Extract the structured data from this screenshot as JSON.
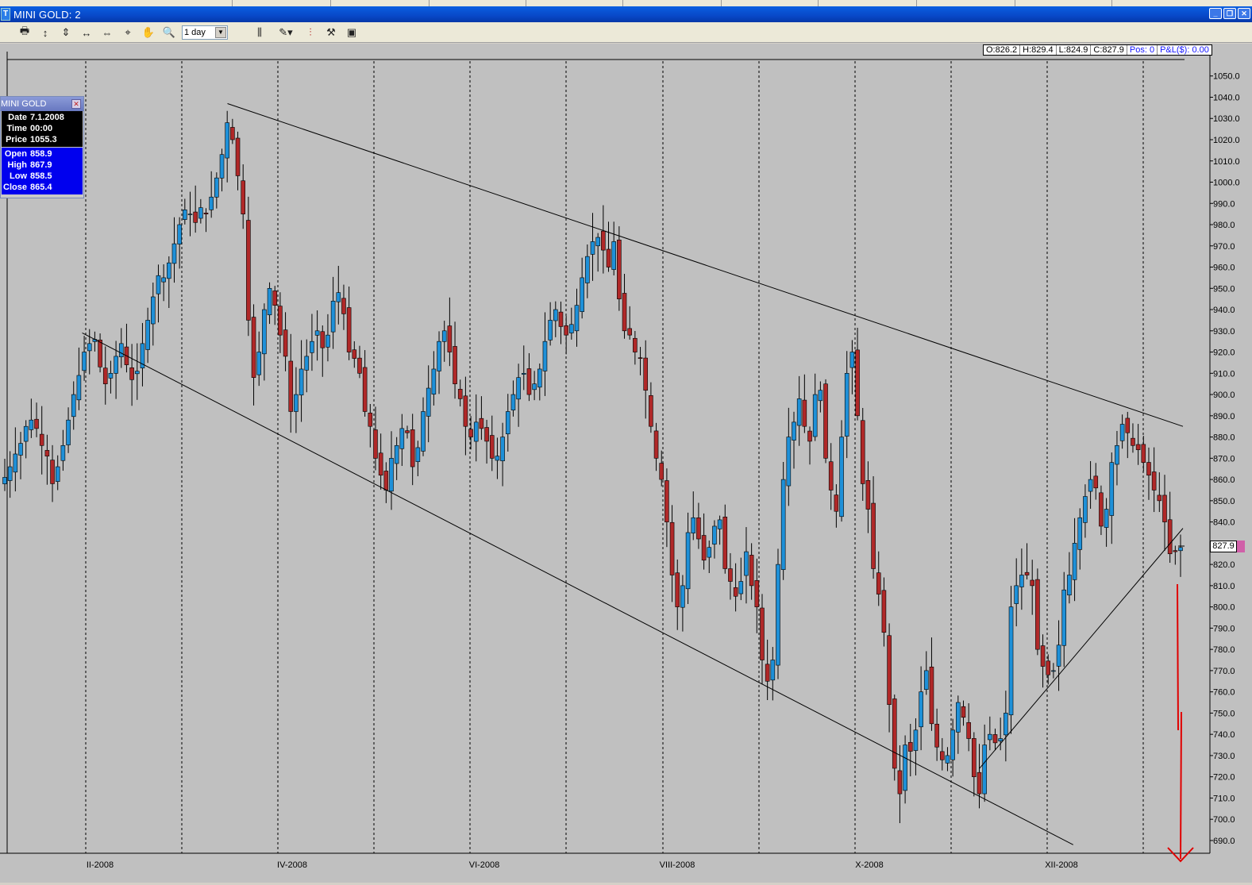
{
  "window": {
    "title": "MINI GOLD: 2",
    "app_icon_glyph": "T"
  },
  "toolbar": {
    "timeframe_value": "1 day",
    "icons": [
      "print-icon",
      "vertical-zoom-icon",
      "vertical-scale-icon",
      "horizontal-zoom-icon",
      "horizontal-scale-icon",
      "cursor-crosshair-icon",
      "hand-pan-icon",
      "magnifier-icon",
      "bar-spacing-icon",
      "drawing-tools-icon",
      "chart-style-icon",
      "indicator-settings-icon",
      "data-window-icon"
    ]
  },
  "ohlc_readout": {
    "open": "O:826.2",
    "high": "H:829.4",
    "low": "L:824.9",
    "close": "C:827.9",
    "pos": "Pos: 0",
    "pnl": "P&L($): 0.00"
  },
  "current_price_tag": "827.9",
  "info_panel": {
    "title": "MINI GOLD",
    "rows_top": [
      {
        "k": "Date",
        "v": "7.1.2008"
      },
      {
        "k": "Time",
        "v": "00:00"
      },
      {
        "k": "Price",
        "v": "1055.3"
      }
    ],
    "rows_bottom": [
      {
        "k": "Open",
        "v": "858.9"
      },
      {
        "k": "High",
        "v": "867.9"
      },
      {
        "k": "Low",
        "v": "858.5"
      },
      {
        "k": "Close",
        "v": "865.4"
      }
    ]
  },
  "colors": {
    "up_candle": "#1e90d8",
    "down_candle": "#b02828",
    "background": "#c0c0c0",
    "arrow": "#e00000"
  },
  "chart_data": {
    "type": "candlestick",
    "instrument": "MINI GOLD",
    "interval": "1 day",
    "ylim": [
      684,
      1057
    ],
    "yticks": [
      690,
      700,
      710,
      720,
      730,
      740,
      750,
      760,
      770,
      780,
      790,
      800,
      810,
      820,
      830,
      840,
      850,
      860,
      870,
      880,
      890,
      900,
      910,
      920,
      930,
      940,
      950,
      960,
      970,
      980,
      990,
      1000,
      1010,
      1020,
      1030,
      1040,
      1050
    ],
    "ytick_labels": [
      "690.0",
      "700.0",
      "710.0",
      "720.0",
      "730.0",
      "740.0",
      "750.0",
      "760.0",
      "770.0",
      "780.0",
      "790.0",
      "800.0",
      "810.0",
      "820.0",
      "830.0",
      "840.0",
      "850.0",
      "860.0",
      "870.0",
      "880.0",
      "890.0",
      "900.0",
      "910.0",
      "920.0",
      "930.0",
      "940.0",
      "950.0",
      "960.0",
      "970.0",
      "980.0",
      "990.0",
      "1000.0",
      "1010.0",
      "1020.0",
      "1030.0",
      "1040.0",
      "1050.0"
    ],
    "xtick_labels": [
      "II-2008",
      "IV-2008",
      "VI-2008",
      "VIII-2008",
      "X-2008",
      "XII-2008"
    ],
    "month_dividers": 13,
    "close_series": [
      861,
      866,
      872,
      877,
      885,
      888,
      884,
      876,
      871,
      858,
      866,
      876,
      888,
      900,
      909,
      920,
      924,
      926,
      913,
      905,
      910,
      918,
      924,
      914,
      907,
      911,
      924,
      935,
      946,
      956,
      955,
      962,
      971,
      980,
      987,
      985,
      981,
      988,
      985,
      993,
      1002,
      1013,
      1028,
      1020,
      1003,
      985,
      935,
      908,
      920,
      940,
      950,
      942,
      928,
      918,
      892,
      900,
      912,
      918,
      925,
      930,
      922,
      928,
      944,
      948,
      938,
      920,
      917,
      910,
      892,
      885,
      870,
      862,
      855,
      870,
      876,
      884,
      882,
      866,
      875,
      892,
      903,
      912,
      925,
      930,
      920,
      905,
      898,
      885,
      880,
      887,
      884,
      878,
      870,
      871,
      880,
      892,
      900,
      908,
      910,
      900,
      905,
      912,
      925,
      935,
      940,
      932,
      928,
      933,
      942,
      955,
      965,
      972,
      974,
      968,
      960,
      972,
      945,
      930,
      928,
      920,
      917,
      902,
      885,
      870,
      860,
      840,
      815,
      800,
      810,
      835,
      842,
      832,
      822,
      828,
      838,
      841,
      818,
      812,
      805,
      812,
      826,
      810,
      800,
      775,
      765,
      775,
      820,
      860,
      880,
      887,
      898,
      885,
      878,
      900,
      902,
      870,
      855,
      845,
      880,
      910,
      920,
      890,
      858,
      846,
      818,
      806,
      788,
      754,
      724,
      712,
      735,
      732,
      742,
      760,
      770,
      745,
      734,
      728,
      730,
      742,
      755,
      748,
      738,
      720,
      712,
      735,
      740,
      736,
      738,
      750,
      800,
      810,
      815,
      815,
      810,
      780,
      772,
      768,
      770,
      782,
      808,
      815,
      830,
      842,
      852,
      860,
      856,
      838,
      846,
      868,
      876,
      886,
      882,
      876,
      874,
      868,
      862,
      855,
      850,
      840,
      825,
      826,
      828
    ],
    "upper_trendline": [
      {
        "x": "2008-03-10",
        "y": 1037
      },
      {
        "x": "2008-12-31",
        "y": 885
      }
    ],
    "lower_trendline": [
      {
        "x": "2008-01-25",
        "y": 929
      },
      {
        "x": "2008-11-27",
        "y": 688
      }
    ],
    "support_trendline": [
      {
        "x": "2008-10-29",
        "y": 724
      },
      {
        "x": "2008-12-31",
        "y": 837
      }
    ]
  }
}
